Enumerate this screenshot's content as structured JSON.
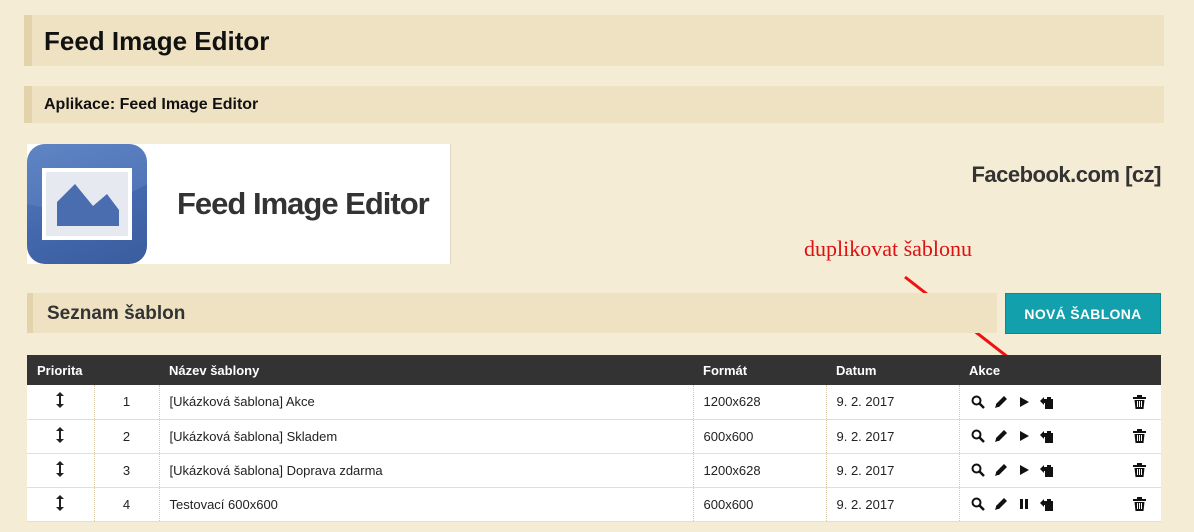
{
  "header": {
    "title": "Feed Image Editor"
  },
  "app_bar": {
    "label": "Aplikace: Feed Image Editor"
  },
  "banner": {
    "title": "Feed Image Editor",
    "store": "Facebook.com [cz]"
  },
  "annotation": {
    "text": "duplikovat šablonu",
    "color": "#dd1111"
  },
  "list_bar": {
    "title": "Seznam šablon"
  },
  "new_button": {
    "label": "NOVÁ ŠABLONA"
  },
  "table": {
    "columns": {
      "priority": "Priorita",
      "name": "Název šablony",
      "format": "Formát",
      "date": "Datum",
      "actions": "Akce"
    },
    "rows": [
      {
        "priority": "1",
        "name": "[Ukázková šablona] Akce",
        "format": "1200x628",
        "date": "9. 2. 2017",
        "toggle": "play"
      },
      {
        "priority": "2",
        "name": "[Ukázková šablona] Skladem",
        "format": "600x600",
        "date": "9. 2. 2017",
        "toggle": "play"
      },
      {
        "priority": "3",
        "name": "[Ukázková šablona] Doprava zdarma",
        "format": "1200x628",
        "date": "9. 2. 2017",
        "toggle": "play"
      },
      {
        "priority": "4",
        "name": "Testovací 600x600",
        "format": "600x600",
        "date": "9. 2. 2017",
        "toggle": "pause"
      }
    ]
  },
  "colors": {
    "accent": "#12a0ad",
    "background": "#f5ecd5",
    "header_bar": "#efe2c3",
    "table_head": "#333333"
  }
}
